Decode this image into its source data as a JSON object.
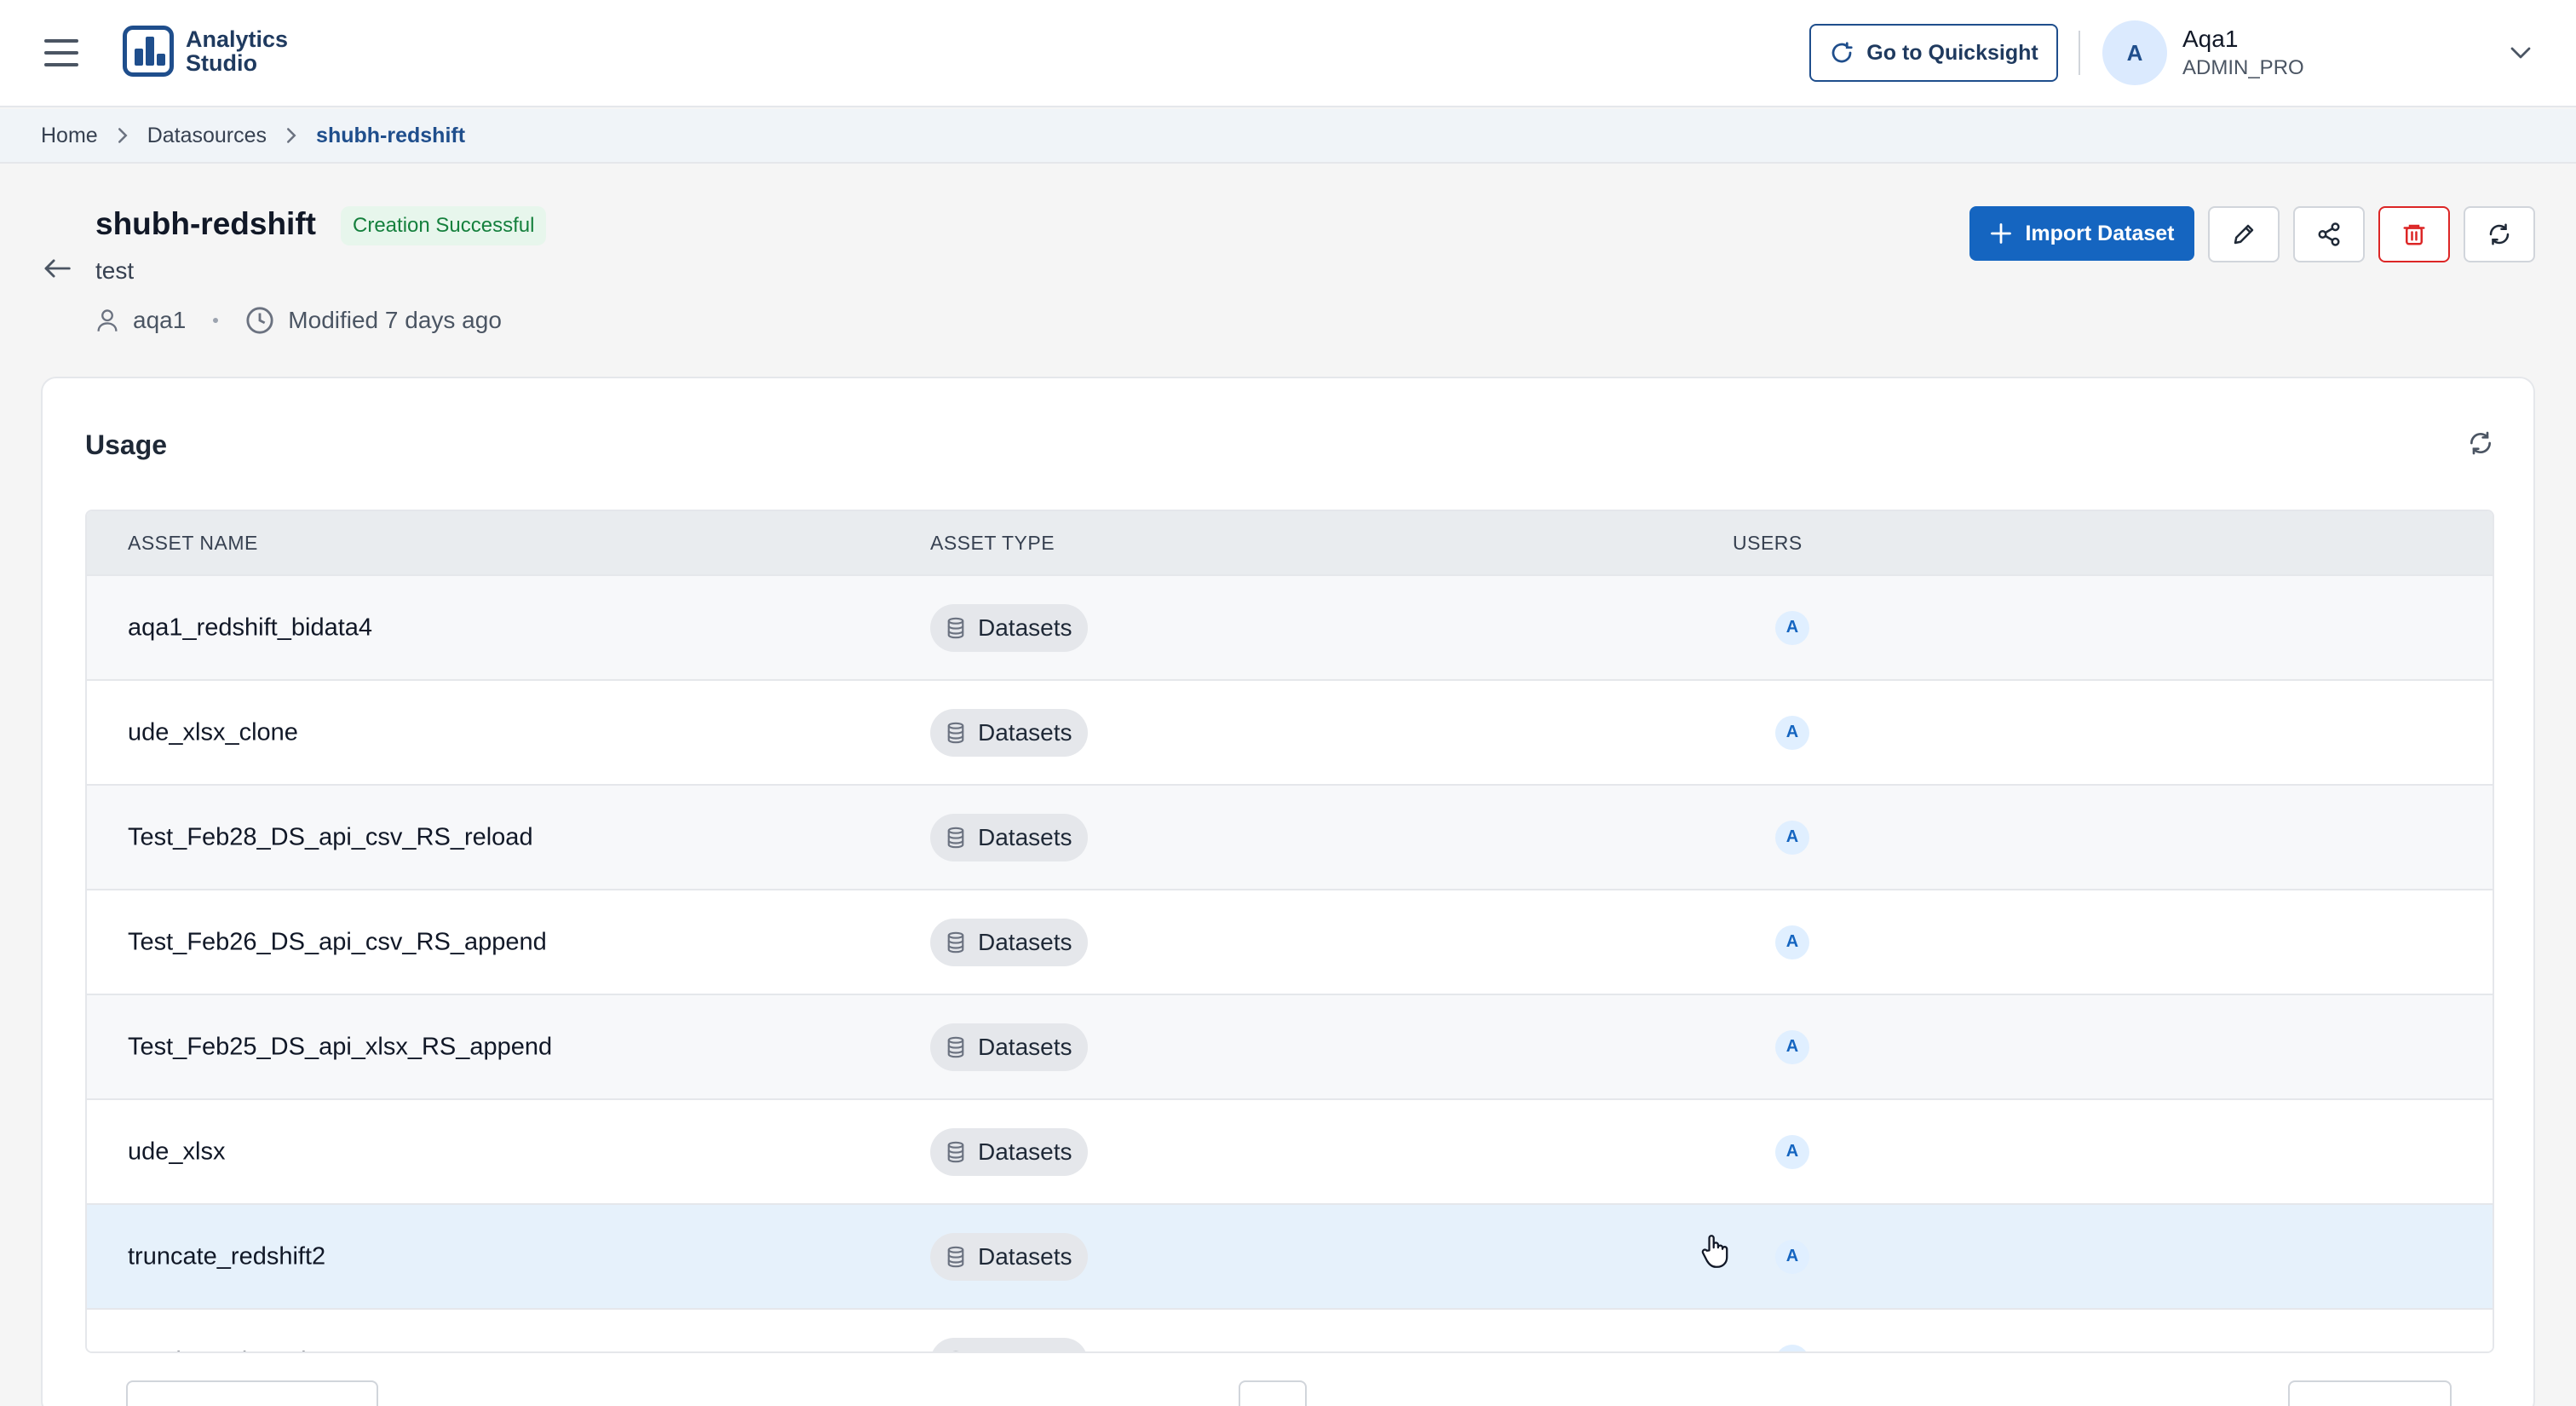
{
  "app": {
    "logo_line1": "Analytics",
    "logo_line2": "Studio",
    "quicksight_label": "Go to Quicksight"
  },
  "user": {
    "initial": "A",
    "name": "Aqa1",
    "role": "ADMIN_PRO"
  },
  "breadcrumb": {
    "items": [
      "Home",
      "Datasources",
      "shubh-redshift"
    ]
  },
  "header": {
    "title": "shubh-redshift",
    "status": "Creation Successful",
    "description": "test",
    "owner": "aqa1",
    "modified": "Modified 7 days ago",
    "import_label": "Import Dataset"
  },
  "usage": {
    "title": "Usage",
    "columns": [
      "ASSET NAME",
      "ASSET TYPE",
      "USERS"
    ],
    "rows": [
      {
        "name": "aqa1_redshift_bidata4",
        "type": "Datasets",
        "user": "A"
      },
      {
        "name": "ude_xlsx_clone",
        "type": "Datasets",
        "user": "A"
      },
      {
        "name": "Test_Feb28_DS_api_csv_RS_reload",
        "type": "Datasets",
        "user": "A"
      },
      {
        "name": "Test_Feb26_DS_api_csv_RS_append",
        "type": "Datasets",
        "user": "A"
      },
      {
        "name": "Test_Feb25_DS_api_xlsx_RS_append",
        "type": "Datasets",
        "user": "A"
      },
      {
        "name": "ude_xlsx",
        "type": "Datasets",
        "user": "A"
      },
      {
        "name": "truncate_redshift2",
        "type": "Datasets",
        "user": "A"
      },
      {
        "name": "testdata_view_dataset",
        "type": "Datasets",
        "user": "A"
      }
    ]
  },
  "colors": {
    "primary": "#1565c0",
    "brand": "#1f4e8c",
    "success_bg": "#e7f6ec",
    "success_text": "#15803d",
    "danger": "#dc2626",
    "row_hover": "#e6f1fb"
  },
  "icons": {
    "menu": "hamburger-icon",
    "refresh_link": "external-refresh-icon",
    "chevron": "chevron-down-icon",
    "back": "arrow-left-icon",
    "owner": "person-icon",
    "clock": "clock-icon",
    "plus": "plus-icon",
    "edit": "pencil-icon",
    "share": "share-icon",
    "delete": "trash-icon",
    "refresh": "refresh-icon",
    "dataset": "database-icon"
  }
}
